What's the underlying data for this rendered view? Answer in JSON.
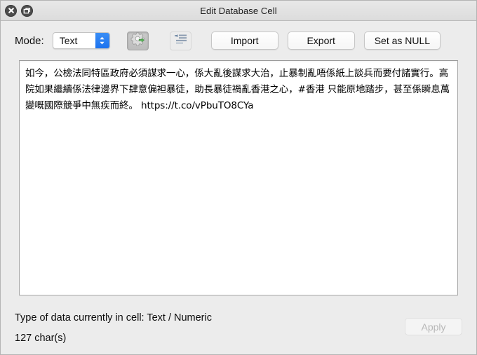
{
  "window": {
    "title": "Edit Database Cell",
    "close_icon": "close-icon",
    "restore_icon": "restore-window-icon"
  },
  "toolbar": {
    "mode_label": "Mode:",
    "mode_value": "Text",
    "mode_options": [
      "Text"
    ],
    "apply_mode_icon": "gear-apply-icon",
    "word_wrap_icon": "text-wrap-icon",
    "import_label": "Import",
    "export_label": "Export",
    "set_null_label": "Set as NULL"
  },
  "editor": {
    "content": "如今，公檢法同特區政府必須謀求一心，係大亂後謀求大治，止暴制亂唔係紙上談兵而要付諸實行。高院如果繼續係法律邊界下肆意偏袒暴徒，助長暴徒禍亂香港之心，#香港 只能原地踏步，甚至係瞬息萬變嘅國際競爭中無疾而終。 https://t.co/vPbuTO8CYa"
  },
  "footer": {
    "type_line": "Type of data currently in cell: Text / Numeric",
    "char_count_line": "127 char(s)",
    "apply_label": "Apply"
  },
  "colors": {
    "accent": "#1b72ef",
    "window_bg": "#ececec",
    "titlebar_bg": "#e0e0e0",
    "field_bg": "#ffffff"
  }
}
